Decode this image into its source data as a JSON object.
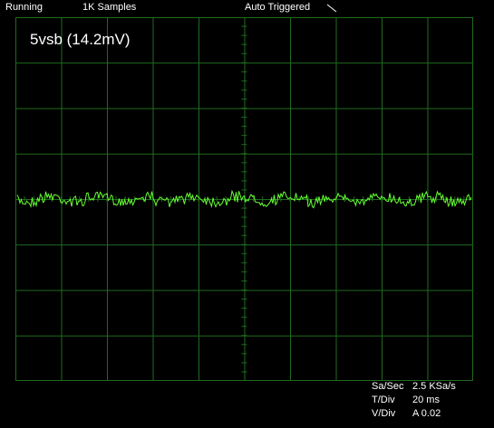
{
  "status_bar": {
    "run_state": "Running",
    "samples": "1K Samples",
    "trigger_mode": "Auto Triggered",
    "trigger_icon": "trigger-slope-icon"
  },
  "trace_label": "5vsb (14.2mV)",
  "parameters": {
    "sample_rate": {
      "label": "Sa/Sec",
      "value": "2.5 KSa/s"
    },
    "time_div": {
      "label": "T/Div",
      "value": "20 ms"
    },
    "volt_div": {
      "label": "V/Div",
      "value": "A 0.02"
    }
  },
  "colors": {
    "background": "#000000",
    "grid": "#1f6b1f",
    "trace": "#66ff33",
    "text": "#ffffff"
  }
}
